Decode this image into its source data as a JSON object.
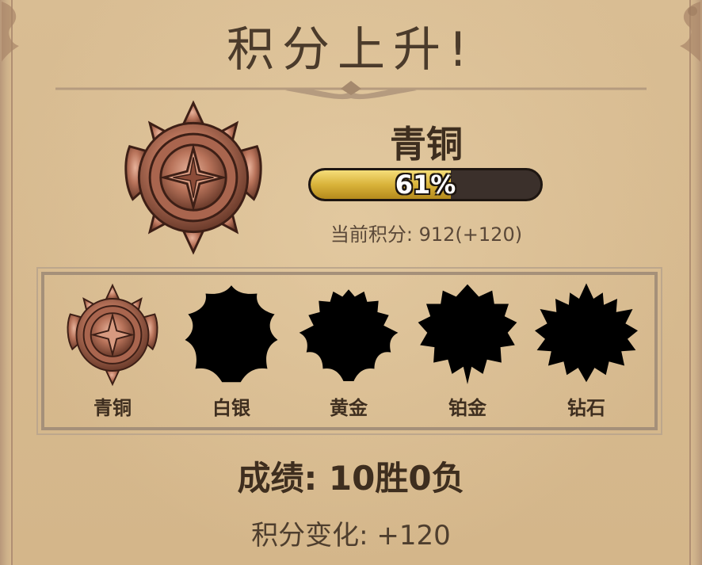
{
  "header": {
    "title": "积分上升!"
  },
  "current_rank": {
    "name": "青铜",
    "progress_percent": 61,
    "progress_text": "61%",
    "score_text": "当前积分: 912(+120)"
  },
  "tiers": [
    {
      "label": "青铜",
      "unlocked": true,
      "icon": "bronze-medal-icon"
    },
    {
      "label": "白银",
      "unlocked": false,
      "icon": "silver-silhouette-icon"
    },
    {
      "label": "黄金",
      "unlocked": false,
      "icon": "gold-silhouette-icon"
    },
    {
      "label": "铂金",
      "unlocked": false,
      "icon": "platinum-silhouette-icon"
    },
    {
      "label": "钻石",
      "unlocked": false,
      "icon": "diamond-silhouette-icon"
    }
  ],
  "results": {
    "record_text": "成绩: 10胜0负",
    "change_text": "积分变化: +120"
  },
  "colors": {
    "background": "#d6b98e",
    "bronze": "#b8735a",
    "progress_fill": "#d9b33a",
    "text_dark": "#3e2e1f"
  }
}
